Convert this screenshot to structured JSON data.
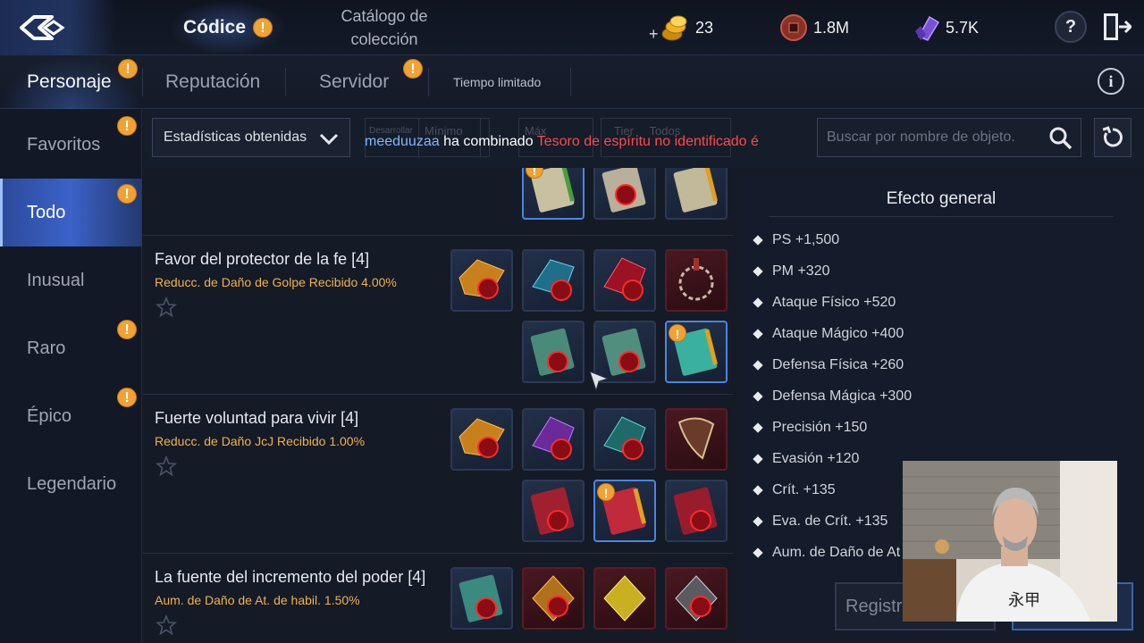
{
  "topbar": {
    "codex_label": "Códice",
    "catalog_label": "Catálogo de colección",
    "currencies": [
      {
        "icon": "gold-coin-icon",
        "value": "23"
      },
      {
        "icon": "copper-coin-icon",
        "value": "1.8M"
      },
      {
        "icon": "purple-crystal-icon",
        "value": "5.7K"
      }
    ],
    "help_label": "?"
  },
  "categories": {
    "tabs": [
      "Personaje",
      "Reputación",
      "Servidor",
      "Tiempo limitado"
    ],
    "active": "Personaje",
    "info_label": "i"
  },
  "sidebar": {
    "items": [
      "Favoritos",
      "Todo",
      "Inusual",
      "Raro",
      "Épico",
      "Legendario"
    ],
    "active": "Todo"
  },
  "filters": {
    "stats_dropdown": "Estadísticas obtenidas",
    "ghost_labels": [
      "Desarrollar",
      "Mínimo",
      "Máx",
      "Tier",
      "Todos"
    ],
    "search_placeholder": "Buscar por nombre de objeto."
  },
  "notice": {
    "user": "meeduuzaa",
    "verb": "ha combinado",
    "item": "Tesoro de espíritu no identificado é"
  },
  "sets": [
    {
      "title": "Favor del protector de la fe [4]",
      "effect": "Reducc. de Daño de Golpe Recibido 4.00%"
    },
    {
      "title": "Fuerte voluntad para vivir [4]",
      "effect": "Reducc. de Daño JcJ Recibido 1.00%"
    },
    {
      "title": "La fuente del incremento del poder [4]",
      "effect": "Aum. de Daño de At. de habil. 1.50%"
    }
  ],
  "effect_panel": {
    "title": "Efecto general",
    "items": [
      "PS +1,500",
      "PM +320",
      "Ataque Físico +520",
      "Ataque Mágico +400",
      "Defensa Física +260",
      "Defensa Mágica +300",
      "Precisión +150",
      "Evasión +120",
      "Crít. +135",
      "Eva. de Crít. +135",
      "Aum. de Daño de At"
    ],
    "register_label": "Registr"
  },
  "colors": {
    "accent_blue": "#3a62c8",
    "alert_orange": "#f0a233",
    "effect_gold": "#f1b24a",
    "notice_red": "#ff4a4a",
    "notice_user": "#7fb8ff"
  }
}
